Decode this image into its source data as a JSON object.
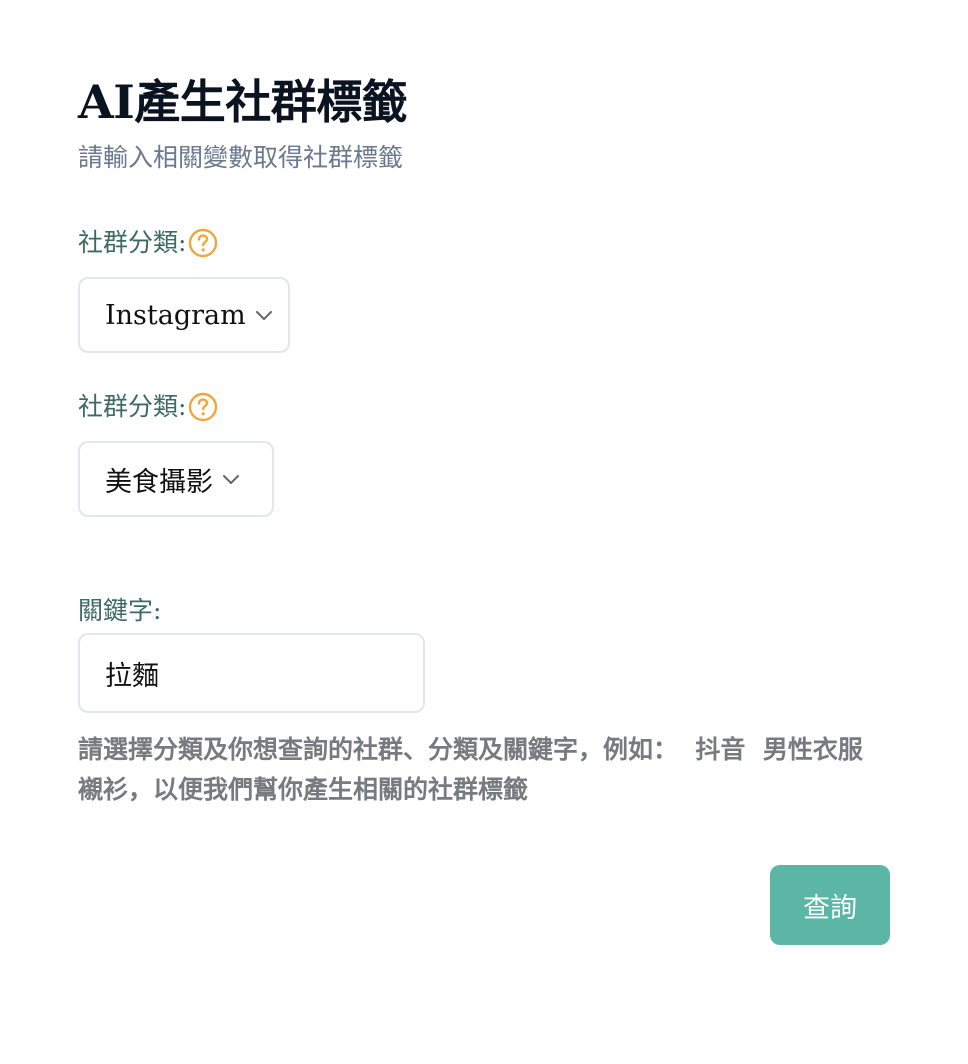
{
  "header": {
    "title": "AI產生社群標籤",
    "subtitle": "請輸入相關變數取得社群標籤"
  },
  "form": {
    "platform": {
      "label": "社群分類:",
      "help_icon": "question-circle-icon",
      "selected": "Instagram"
    },
    "category": {
      "label": "社群分類:",
      "help_icon": "question-circle-icon",
      "selected": "美食攝影"
    },
    "keyword": {
      "label": "關鍵字:",
      "value": "拉麵"
    },
    "hint": "請選擇分類及你想查詢的社群、分類及關鍵字，例如：  抖音  男性衣服  襯衫，以便我們幫你產生相關的社群標籤",
    "submit_label": "查詢"
  },
  "colors": {
    "accent": "#5bb6a6",
    "label": "#3d6b61",
    "help_icon": "#f0a63b",
    "subtitle": "#6b7890",
    "hint": "#777b80"
  }
}
